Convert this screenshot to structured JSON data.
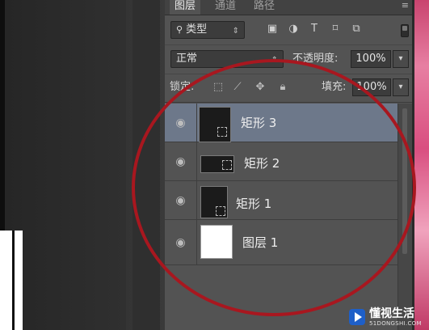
{
  "panel": {
    "tabs": [
      "图层",
      "通道",
      "路径"
    ],
    "menu_icon": "≡"
  },
  "filter": {
    "type_label": "类型",
    "icons": [
      "image-filter-icon",
      "adjustment-filter-icon",
      "text-filter-icon",
      "shape-filter-icon",
      "smart-object-filter-icon"
    ]
  },
  "blend": {
    "mode": "正常",
    "opacity_label": "不透明度:",
    "opacity_value": "100%"
  },
  "lock": {
    "label": "锁定:",
    "fill_label": "填充:",
    "fill_value": "100%",
    "icons": [
      "lock-transparent-icon",
      "lock-brush-icon",
      "lock-move-icon",
      "lock-all-icon"
    ]
  },
  "layers": [
    {
      "name": "矩形 3",
      "selected": true,
      "thumb": "dark"
    },
    {
      "name": "矩形 2",
      "selected": false,
      "thumb": "dark"
    },
    {
      "name": "矩形 1",
      "selected": false,
      "thumb": "dark"
    },
    {
      "name": "图层 1",
      "selected": false,
      "thumb": "white"
    }
  ],
  "colors": {
    "panel_bg": "#535353",
    "selected_layer": "#6d788a",
    "annotation_circle": "#a8171f"
  },
  "watermark": {
    "title": "懂视生活",
    "subtitle": "51DONGSHI.COM"
  }
}
